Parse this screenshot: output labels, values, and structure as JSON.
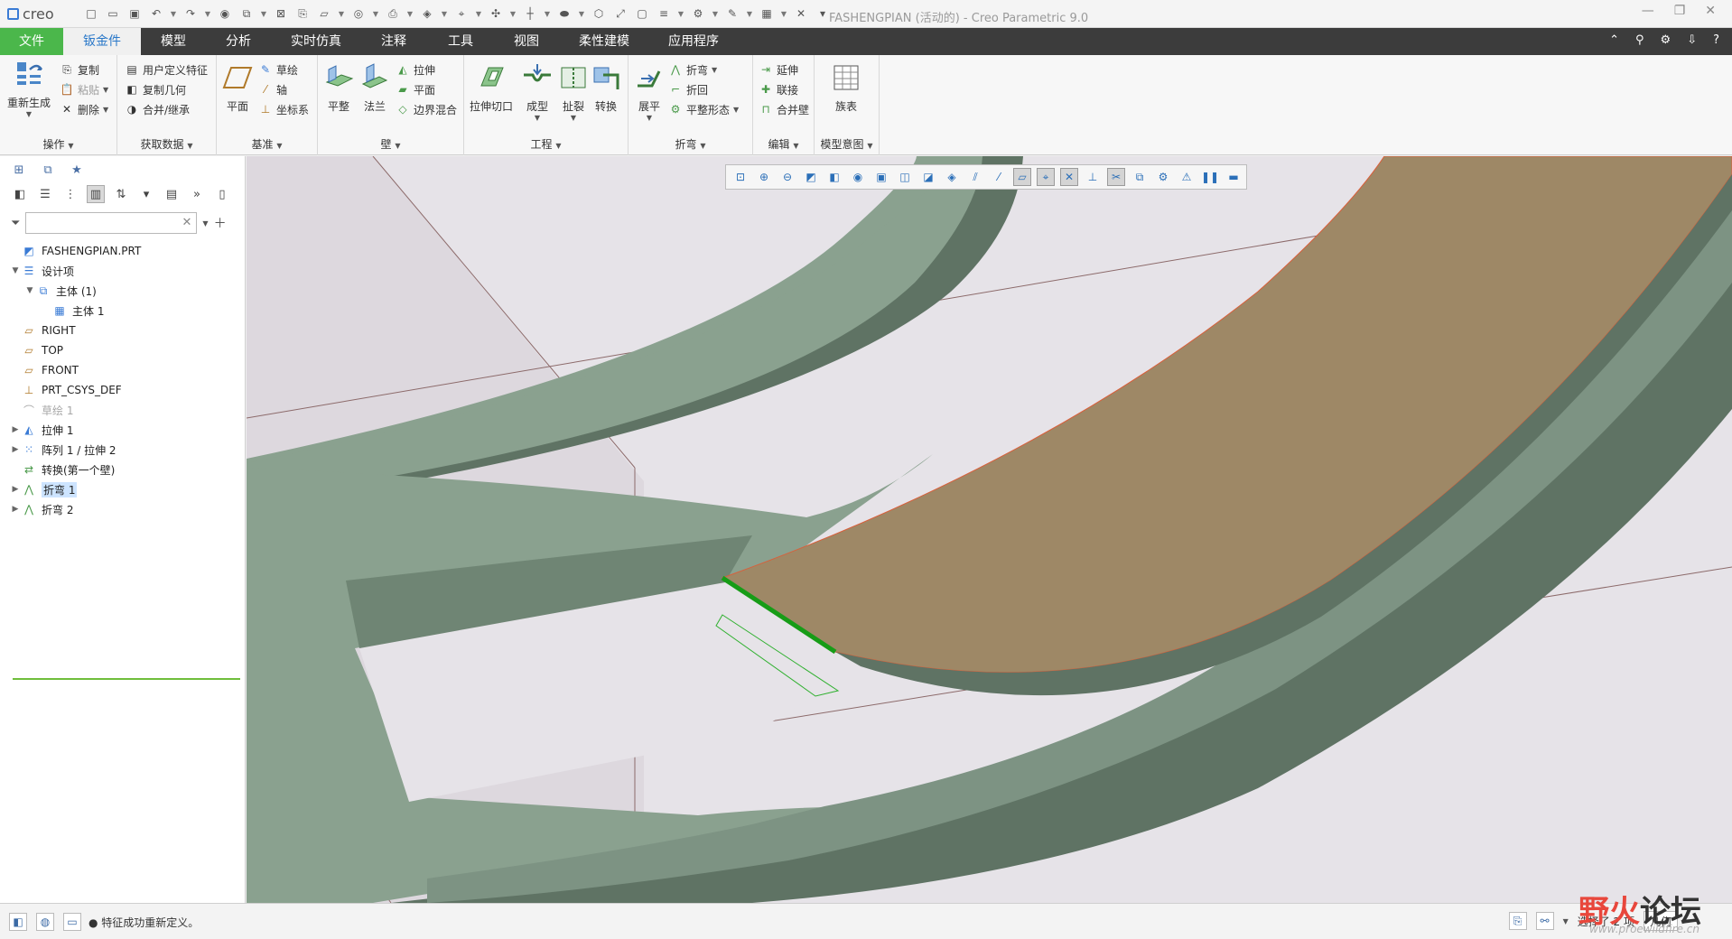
{
  "app": {
    "logo": "creo",
    "window_title": "FASHENGPIAN (活动的) - Creo Parametric 9.0"
  },
  "menu": {
    "tabs": [
      "文件",
      "钣金件",
      "模型",
      "分析",
      "实时仿真",
      "注释",
      "工具",
      "视图",
      "柔性建模",
      "应用程序"
    ],
    "active": "钣金件"
  },
  "ribbon": {
    "operations": {
      "label": "操作",
      "regenerate": "重新生成",
      "copy": "复制",
      "paste": "粘贴",
      "delete": "删除"
    },
    "get_data": {
      "label": "获取数据",
      "user_defined_feature": "用户定义特征",
      "copy_geometry": "复制几何",
      "merge_inherit": "合并/继承"
    },
    "datum": {
      "label": "基准",
      "plane": "平面",
      "sketch": "草绘",
      "axis": "轴",
      "csys": "坐标系"
    },
    "wall": {
      "label": "壁",
      "flat": "平整",
      "flange": "法兰",
      "extrude": "拉伸",
      "planar": "平面",
      "boundary_blend": "边界混合"
    },
    "engineering": {
      "label": "工程",
      "extrude_cut": "拉伸切口",
      "form": "成型",
      "rip": "扯裂",
      "convert": "转换"
    },
    "bends": {
      "label": "折弯",
      "unbend": "展平",
      "bend": "折弯",
      "bend_back": "折回",
      "flat_state": "平整形态"
    },
    "editing": {
      "label": "编辑",
      "extend": "延伸",
      "join": "联接",
      "merge_walls": "合并壁"
    },
    "model_intent": {
      "label": "模型意图",
      "family_table": "族表"
    }
  },
  "model_tree": {
    "filter_placeholder": "",
    "items": [
      {
        "label": "FASHENGPIAN.PRT"
      },
      {
        "label": "设计项"
      },
      {
        "label": "主体 (1)"
      },
      {
        "label": "主体 1"
      },
      {
        "label": "RIGHT"
      },
      {
        "label": "TOP"
      },
      {
        "label": "FRONT"
      },
      {
        "label": "PRT_CSYS_DEF"
      },
      {
        "label": "草绘 1"
      },
      {
        "label": "拉伸 1"
      },
      {
        "label": "阵列 1 / 拉伸 2"
      },
      {
        "label": "转换(第一个壁)"
      },
      {
        "label": "折弯 1"
      },
      {
        "label": "折弯 2"
      }
    ]
  },
  "status": {
    "message": "特征成功重新定义。",
    "selection": "选择了 2 项",
    "filter": "几何"
  },
  "watermark": {
    "text_black1": "野",
    "text_red": "火",
    "text_black2": "论坛",
    "url": "www.proewildfire.cn"
  },
  "colors": {
    "menu_bg": "#3c3c3c",
    "file_tab": "#4bb74b",
    "sheet_face": "#8aa18f",
    "sheet_side": "#5f7364",
    "selected_face": "#9e8866",
    "selected_edge": "#179c17",
    "viewport_bg": "#e6e3e8"
  }
}
